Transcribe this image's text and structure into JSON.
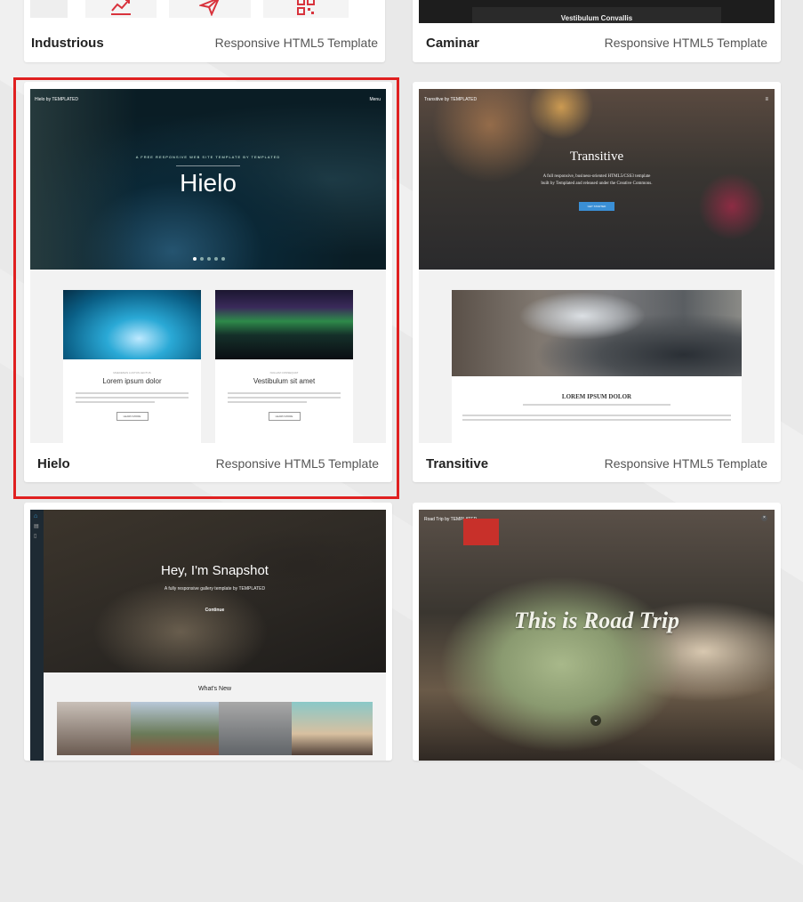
{
  "cards": [
    {
      "name": "Industrious",
      "kind": "Responsive HTML5 Template"
    },
    {
      "name": "Caminar",
      "kind": "Responsive HTML5 Template",
      "banner": "Vestibulum Convallis"
    },
    {
      "name": "Hielo",
      "kind": "Responsive HTML5 Template",
      "preview": {
        "brand": "Hielo by TEMPLATED",
        "menu": "Menu",
        "tagline": "A FREE RESPONSIVE WEB SITE TEMPLATE BY TEMPLATED",
        "hero_title": "Hielo",
        "box1_title": "Lorem ipsum dolor",
        "box2_title": "Vestibulum sit amet",
        "button": "LEARN MORE"
      }
    },
    {
      "name": "Transitive",
      "kind": "Responsive HTML5 Template",
      "preview": {
        "brand": "Transitive by TEMPLATED",
        "hero_title": "Transitive",
        "hero_text1": "A full responsive, business-oriented HTML5/CSS3 template",
        "hero_text2": "built by Templated and released under the Creative Commons.",
        "button": "GET STARTED",
        "section_title": "LOREM IPSUM DOLOR"
      }
    },
    {
      "name": "Snapshot",
      "preview": {
        "hero_title": "Hey, I'm Snapshot",
        "hero_text": "A fully responsive gallery template by TEMPLATED",
        "cta": "Continue",
        "section_title": "What's New"
      }
    },
    {
      "name": "Road Trip",
      "preview": {
        "brand": "Road Trip by TEMPLATED",
        "hero_title": "This is Road Trip"
      }
    }
  ],
  "colors": {
    "selection": "#e02020",
    "accent_red": "#d8323c"
  }
}
